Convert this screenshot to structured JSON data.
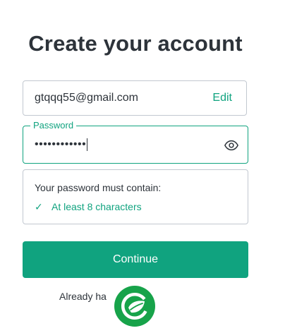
{
  "header": {
    "title": "Create your account"
  },
  "email": {
    "value": "gtqqq55@gmail.com",
    "edit_label": "Edit"
  },
  "password": {
    "label": "Password",
    "masked_value": "••••••••••••"
  },
  "requirements": {
    "title": "Your password must contain:",
    "items": [
      {
        "icon": "✓",
        "label": "At least 8 characters",
        "satisfied": true
      }
    ]
  },
  "actions": {
    "continue_label": "Continue"
  },
  "footer": {
    "text": "Already ha"
  },
  "colors": {
    "accent": "#10a37f",
    "text": "#2d333a",
    "border": "#c2c8d0",
    "logo_green": "#17a34a"
  }
}
